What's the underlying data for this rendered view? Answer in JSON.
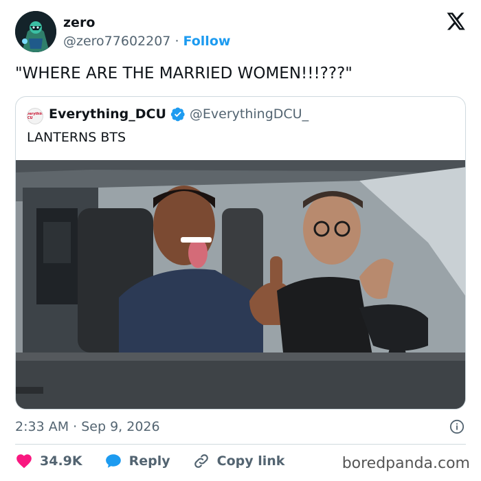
{
  "author": {
    "name": "zero",
    "handle": "@zero77602207",
    "separator": "·",
    "follow_label": "Follow"
  },
  "tweet": {
    "text": "\"WHERE ARE THE MARRIED WOMEN!!!???\"",
    "timestamp": "2:33 AM · Sep 9, 2026"
  },
  "quoted": {
    "name": "Everything_DCU",
    "handle": "@EverythingDCU_",
    "text": "LANTERNS BTS",
    "avatar_text": "Everything DCU"
  },
  "actions": {
    "like_count": "34.9K",
    "reply_label": "Reply",
    "copy_label": "Copy link"
  },
  "watermark": "boredpanda.com",
  "icons": {
    "brand": "x-logo-icon",
    "verified": "verified-badge-icon",
    "info": "info-icon",
    "like": "heart-icon",
    "reply": "speech-bubble-icon",
    "copy": "link-icon"
  },
  "colors": {
    "link_blue": "#1d9bf0",
    "heart_red": "#f91880",
    "text_primary": "#0f1419",
    "text_secondary": "#536471",
    "border": "#cfd9de"
  }
}
